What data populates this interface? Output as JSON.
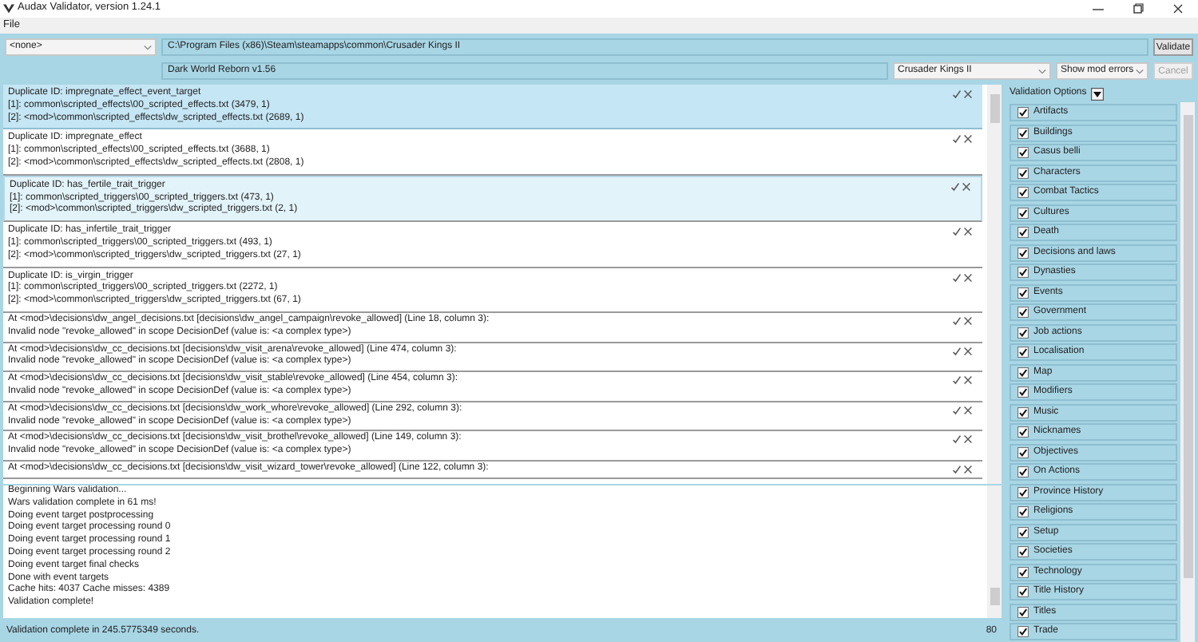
{
  "window": {
    "title": "Audax Validator, version 1.24.1"
  },
  "menu": [
    "File"
  ],
  "toolbar": {
    "mod_dropdown": "<none>",
    "game_path": "C:\\Program Files (x86)\\Steam\\steamapps\\common\\Crusader Kings II",
    "mod_name": "Dark World Reborn v1.56",
    "game_dropdown": "Crusader Kings II",
    "filter_dropdown": "Show mod errors",
    "validate_button": "Validate",
    "cancel_button": {
      "label": "Cancel",
      "disabled": true
    }
  },
  "errors": [
    {
      "kind": "duplicate",
      "selected": true,
      "highlighted": false,
      "lines": [
        "Duplicate ID: impregnate_effect_event_target",
        "[1]: common\\scripted_effects\\00_scripted_effects.txt (3479, 1)",
        "[2]: <mod>\\common\\scripted_effects\\dw_scripted_effects.txt (2689, 1)"
      ]
    },
    {
      "kind": "duplicate",
      "selected": false,
      "highlighted": false,
      "lines": [
        "Duplicate ID: impregnate_effect",
        "[1]: common\\scripted_effects\\00_scripted_effects.txt (3688, 1)",
        "[2]: <mod>\\common\\scripted_effects\\dw_scripted_effects.txt (2808, 1)"
      ]
    },
    {
      "kind": "duplicate",
      "selected": false,
      "highlighted": true,
      "lines": [
        "Duplicate ID: has_fertile_trait_trigger",
        "[1]: common\\scripted_triggers\\00_scripted_triggers.txt (473, 1)",
        "[2]: <mod>\\common\\scripted_triggers\\dw_scripted_triggers.txt (2, 1)"
      ]
    },
    {
      "kind": "duplicate",
      "selected": false,
      "highlighted": false,
      "lines": [
        "Duplicate ID: has_infertile_trait_trigger",
        "[1]: common\\scripted_triggers\\00_scripted_triggers.txt (493, 1)",
        "[2]: <mod>\\common\\scripted_triggers\\dw_scripted_triggers.txt (27, 1)"
      ]
    },
    {
      "kind": "duplicate",
      "selected": false,
      "highlighted": false,
      "lines": [
        "Duplicate ID: is_virgin_trigger",
        "[1]: common\\scripted_triggers\\00_scripted_triggers.txt (2272, 1)",
        "[2]: <mod>\\common\\scripted_triggers\\dw_scripted_triggers.txt (67, 1)"
      ]
    },
    {
      "kind": "invalid",
      "selected": false,
      "highlighted": false,
      "lines": [
        "At <mod>\\decisions\\dw_angel_decisions.txt [decisions\\dw_angel_campaign\\revoke_allowed] (Line 18, column 3):",
        "Invalid node \"revoke_allowed\" in scope DecisionDef (value is: <a complex type>)"
      ]
    },
    {
      "kind": "invalid",
      "selected": false,
      "highlighted": false,
      "lines": [
        "At <mod>\\decisions\\dw_cc_decisions.txt [decisions\\dw_visit_arena\\revoke_allowed] (Line 474, column 3):",
        "Invalid node \"revoke_allowed\" in scope DecisionDef (value is: <a complex type>)"
      ]
    },
    {
      "kind": "invalid",
      "selected": false,
      "highlighted": false,
      "lines": [
        "At <mod>\\decisions\\dw_cc_decisions.txt [decisions\\dw_visit_stable\\revoke_allowed] (Line 454, column 3):",
        "Invalid node \"revoke_allowed\" in scope DecisionDef (value is: <a complex type>)"
      ]
    },
    {
      "kind": "invalid",
      "selected": false,
      "highlighted": false,
      "lines": [
        "At <mod>\\decisions\\dw_cc_decisions.txt [decisions\\dw_work_whore\\revoke_allowed] (Line 292, column 3):",
        "Invalid node \"revoke_allowed\" in scope DecisionDef (value is: <a complex type>)"
      ]
    },
    {
      "kind": "invalid",
      "selected": false,
      "highlighted": false,
      "lines": [
        "At <mod>\\decisions\\dw_cc_decisions.txt [decisions\\dw_visit_brothel\\revoke_allowed] (Line 149, column 3):",
        "Invalid node \"revoke_allowed\" in scope DecisionDef (value is: <a complex type>)"
      ]
    },
    {
      "kind": "invalid",
      "selected": false,
      "highlighted": false,
      "lines": [
        "At <mod>\\decisions\\dw_cc_decisions.txt [decisions\\dw_visit_wizard_tower\\revoke_allowed] (Line 122, column 3):"
      ]
    }
  ],
  "log": [
    "Beginning Wars validation...",
    "Wars validation complete in 61 ms!",
    "Doing event target postprocessing",
    "Doing event target processing round 0",
    "Doing event target processing round 1",
    "Doing event target processing round 2",
    "Doing event target final checks",
    "Done with event targets",
    "Cache hits: 4037 Cache misses: 4389",
    "Validation complete!"
  ],
  "status_bar": {
    "message": "Validation complete in 245.5775349 seconds.",
    "count": "80"
  },
  "validation_options": {
    "title": "Validation Options",
    "items": [
      {
        "label": "Artifacts",
        "checked": true
      },
      {
        "label": "Buildings",
        "checked": true
      },
      {
        "label": "Casus belli",
        "checked": true
      },
      {
        "label": "Characters",
        "checked": true
      },
      {
        "label": "Combat Tactics",
        "checked": true
      },
      {
        "label": "Cultures",
        "checked": true
      },
      {
        "label": "Death",
        "checked": true
      },
      {
        "label": "Decisions and laws",
        "checked": true
      },
      {
        "label": "Dynasties",
        "checked": true
      },
      {
        "label": "Events",
        "checked": true
      },
      {
        "label": "Government",
        "checked": true
      },
      {
        "label": "Job actions",
        "checked": true
      },
      {
        "label": "Localisation",
        "checked": true
      },
      {
        "label": "Map",
        "checked": true
      },
      {
        "label": "Modifiers",
        "checked": true
      },
      {
        "label": "Music",
        "checked": true
      },
      {
        "label": "Nicknames",
        "checked": true
      },
      {
        "label": "Objectives",
        "checked": true
      },
      {
        "label": "On Actions",
        "checked": true
      },
      {
        "label": "Province History",
        "checked": true
      },
      {
        "label": "Religions",
        "checked": true
      },
      {
        "label": "Setup",
        "checked": true
      },
      {
        "label": "Societies",
        "checked": true
      },
      {
        "label": "Technology",
        "checked": true
      },
      {
        "label": "Title History",
        "checked": true
      },
      {
        "label": "Titles",
        "checked": true
      },
      {
        "label": "Trade",
        "checked": true
      }
    ]
  }
}
